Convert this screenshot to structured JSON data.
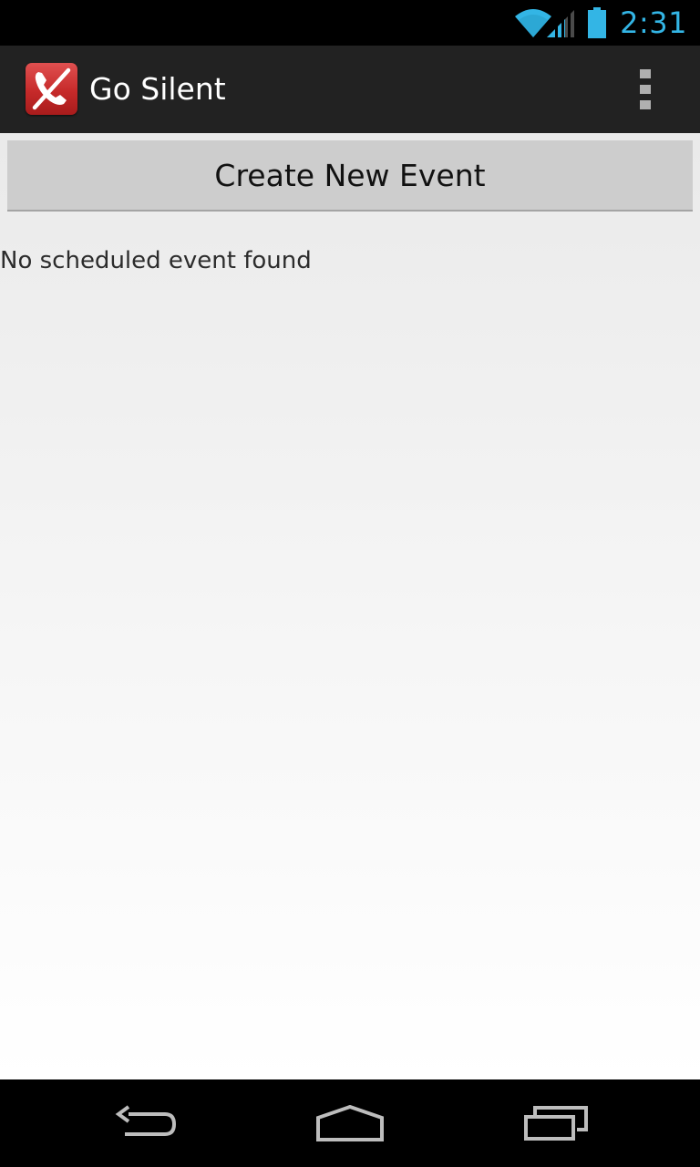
{
  "status_bar": {
    "time": "2:31",
    "icons": [
      "wifi-icon",
      "signal-icon",
      "battery-icon"
    ],
    "accent_color": "#33b5e5"
  },
  "action_bar": {
    "title": "Go Silent",
    "app_icon": "silent-phone-icon",
    "overflow_icon": "overflow-menu-icon",
    "background_color": "#222222"
  },
  "main": {
    "create_button_label": "Create New Event",
    "empty_message": "No scheduled event found"
  },
  "nav_bar": {
    "icons": [
      "back-icon",
      "home-icon",
      "recents-icon"
    ]
  }
}
